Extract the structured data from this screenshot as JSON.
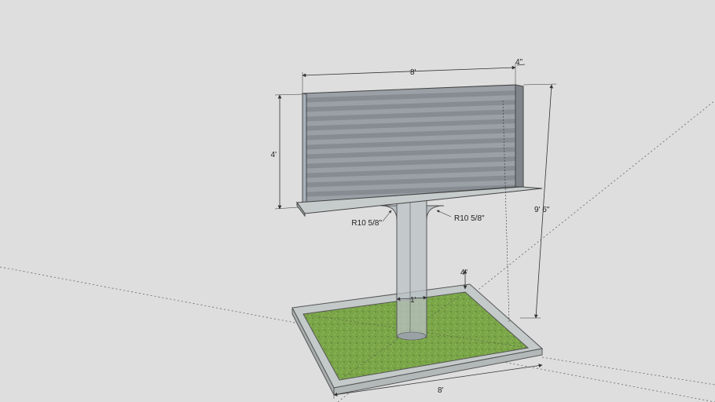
{
  "colors": {
    "background": "#dedede",
    "panel": "#8f959b",
    "panel_stripe": "#a5abb1",
    "concrete": "#b9bfbf",
    "grass": "#7fa84a",
    "grass_dark": "#5f8c36",
    "dimension_line": "#333333",
    "axis_line": "#666666"
  },
  "dimensions": {
    "sign_width": "8'",
    "sign_depth": "4\"",
    "sign_height": "4'",
    "overall_height": "9' 6\"",
    "radius_left": "R10 5/8\"",
    "radius_right": "R10 5/8\"",
    "post_width": "1'",
    "curb_height": "4\"",
    "base_width": "8'"
  },
  "icons": {
    "arrowhead": "dimension-arrowhead-icon"
  }
}
